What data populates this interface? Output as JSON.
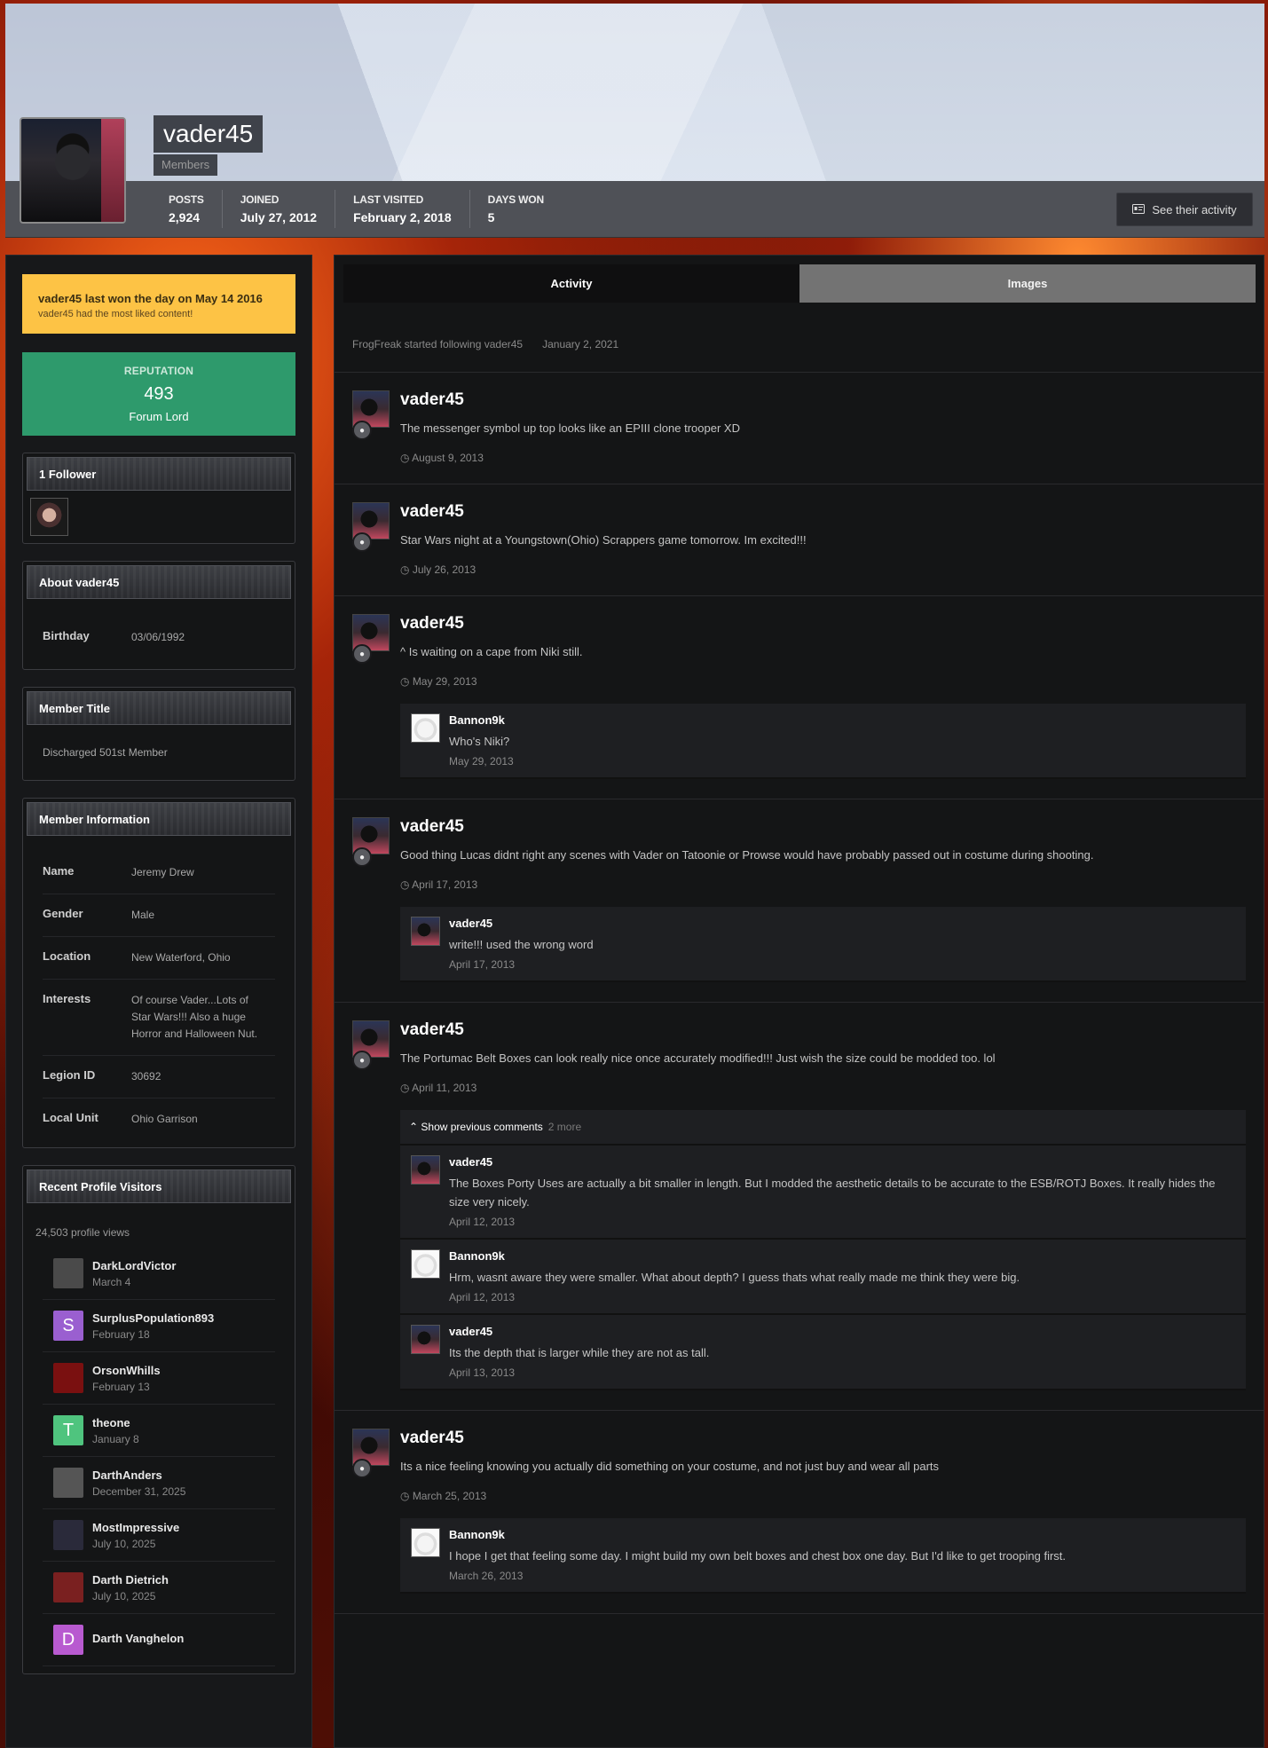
{
  "profile": {
    "username": "vader45",
    "group": "Members",
    "stats": [
      {
        "label": "Posts",
        "value": "2,924"
      },
      {
        "label": "Joined",
        "value": "July 27, 2012"
      },
      {
        "label": "Last visited",
        "value": "February 2, 2018"
      },
      {
        "label": "Days Won",
        "value": "5"
      }
    ],
    "activity_button": "See their activity"
  },
  "sidebar": {
    "won": {
      "title": "vader45 last won the day on May 14 2016",
      "subtitle": "vader45 had the most liked content!"
    },
    "reputation": {
      "label": "REPUTATION",
      "value": "493",
      "title": "Forum Lord"
    },
    "followers": {
      "heading": "1 Follower"
    },
    "about": {
      "heading": "About vader45",
      "rows": [
        {
          "k": "Birthday",
          "v": "03/06/1992"
        }
      ]
    },
    "member_title": {
      "heading": "Member Title",
      "value": "Discharged 501st Member"
    },
    "member_info": {
      "heading": "Member Information",
      "rows": [
        {
          "k": "Name",
          "v": "Jeremy Drew"
        },
        {
          "k": "Gender",
          "v": "Male"
        },
        {
          "k": "Location",
          "v": "New Waterford, Ohio"
        },
        {
          "k": "Interests",
          "v": "Of course Vader...Lots of Star Wars!!! Also a huge Horror and Halloween Nut."
        },
        {
          "k": "Legion ID",
          "v": "30692"
        },
        {
          "k": "Local Unit",
          "v": "Ohio Garrison"
        }
      ]
    },
    "visitors": {
      "heading": "Recent Profile Visitors",
      "views": "24,503 profile views",
      "list": [
        {
          "name": "DarkLordVictor",
          "date": "March 4",
          "letter": "",
          "color": "#4a4a4a"
        },
        {
          "name": "SurplusPopulation893",
          "date": "February 18",
          "letter": "S",
          "color": "#9a5fd0"
        },
        {
          "name": "OrsonWhills",
          "date": "February 13",
          "letter": "",
          "color": "#7a1010"
        },
        {
          "name": "theone",
          "date": "January 8",
          "letter": "T",
          "color": "#4fc47e"
        },
        {
          "name": "DarthAnders",
          "date": "December 31, 2025",
          "letter": "",
          "color": "#555"
        },
        {
          "name": "MostImpressive",
          "date": "July 10, 2025",
          "letter": "",
          "color": "#2a2a3a"
        },
        {
          "name": "Darth Dietrich",
          "date": "July 10, 2025",
          "letter": "",
          "color": "#7a2020"
        },
        {
          "name": "Darth Vanghelon",
          "date": "",
          "letter": "D",
          "color": "#b85ad0"
        }
      ]
    }
  },
  "tabs": {
    "activity": "Activity",
    "images": "Images"
  },
  "feed": {
    "follow": {
      "text": "FrogFreak started following vader45",
      "date": "January 2, 2021"
    },
    "entries": [
      {
        "author": "vader45",
        "text": "The messenger symbol up top looks like an EPIII clone trooper XD",
        "date": "August 9, 2013"
      },
      {
        "author": "vader45",
        "text": "Star Wars night at a Youngstown(Ohio) Scrappers game tomorrow. Im excited!!!",
        "date": "July 26, 2013"
      },
      {
        "author": "vader45",
        "text": "^ Is waiting on a cape from Niki still.",
        "date": "May 29, 2013",
        "comments": [
          {
            "author": "Bannon9k",
            "text": "Who's Niki?",
            "date": "May 29, 2013"
          }
        ]
      },
      {
        "author": "vader45",
        "text": "Good thing Lucas didnt right any scenes with Vader on Tatoonie or Prowse would have probably passed out in costume during shooting.",
        "date": "April 17, 2013",
        "comments": [
          {
            "author": "vader45",
            "text": "write!!! used the wrong word",
            "date": "April 17, 2013"
          }
        ]
      },
      {
        "author": "vader45",
        "text": "The Portumac Belt Boxes can look really nice once accurately modified!!! Just wish the size could be modded too. lol",
        "date": "April 11, 2013",
        "show_prev": {
          "label": "Show previous comments",
          "more": "2 more"
        },
        "comments": [
          {
            "author": "vader45",
            "text": "The Boxes Porty Uses are actually a bit smaller in length. But I modded the aesthetic details to be accurate to the ESB/ROTJ Boxes. It really hides the size very nicely.",
            "date": "April 12, 2013"
          },
          {
            "author": "Bannon9k",
            "text": "Hrm, wasnt aware they were smaller. What about depth? I guess thats what really made me think they were big.",
            "date": "April 12, 2013"
          },
          {
            "author": "vader45",
            "text": "Its the depth that is larger while they are not as tall.",
            "date": "April 13, 2013"
          }
        ]
      },
      {
        "author": "vader45",
        "text": "Its a nice feeling knowing you actually did something on your costume, and not just buy and wear all parts",
        "date": "March 25, 2013",
        "comments": [
          {
            "author": "Bannon9k",
            "text": "I hope I get that feeling some day. I might build my own belt boxes and chest box one day. But I'd like to get trooping first.",
            "date": "March 26, 2013"
          }
        ]
      }
    ]
  }
}
